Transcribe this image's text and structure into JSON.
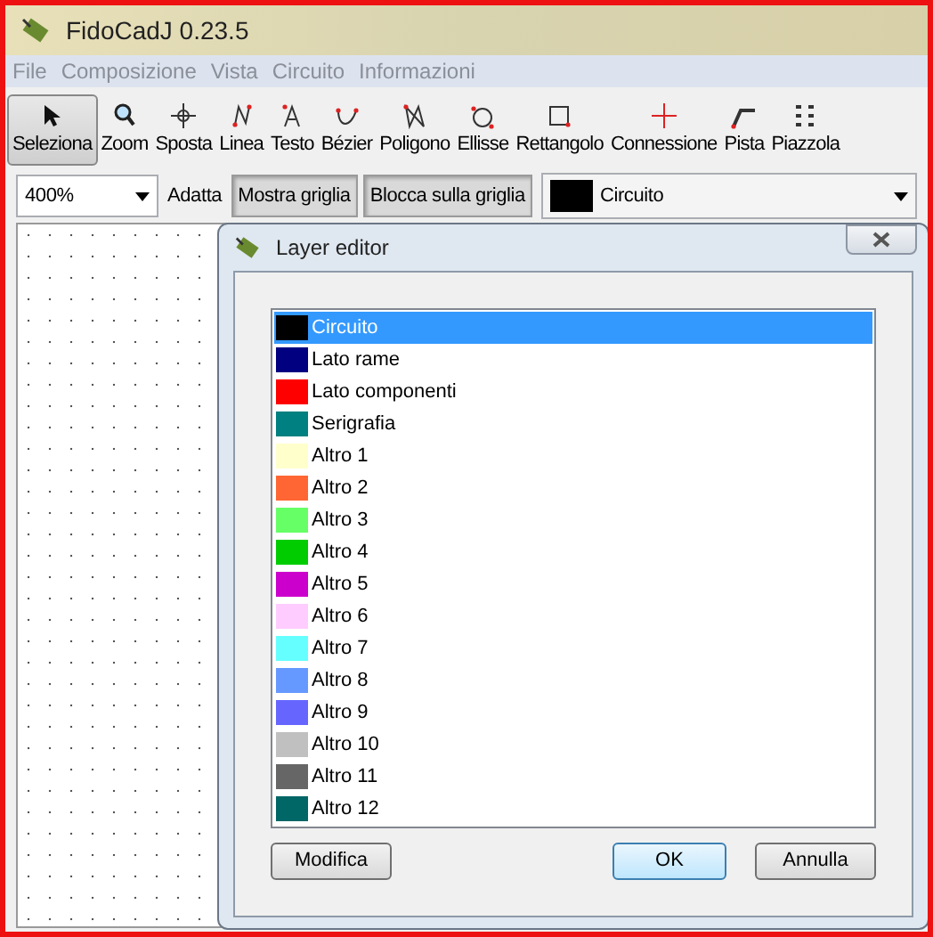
{
  "window": {
    "title": "FidoCadJ 0.23.5"
  },
  "menu": [
    "File",
    "Composizione",
    "Vista",
    "Circuito",
    "Informazioni"
  ],
  "tools": [
    {
      "label": "Seleziona",
      "selected": true
    },
    {
      "label": "Zoom",
      "selected": false
    },
    {
      "label": "Sposta",
      "selected": false
    },
    {
      "label": "Linea",
      "selected": false
    },
    {
      "label": "Testo",
      "selected": false
    },
    {
      "label": "Bézier",
      "selected": false
    },
    {
      "label": "Poligono",
      "selected": false
    },
    {
      "label": "Ellisse",
      "selected": false
    },
    {
      "label": "Rettangolo",
      "selected": false
    },
    {
      "label": "Connessione",
      "selected": false
    },
    {
      "label": "Pista",
      "selected": false
    },
    {
      "label": "Piazzola",
      "selected": false
    }
  ],
  "zoom_select": {
    "value": "400%"
  },
  "fit_button": {
    "label": "Adatta"
  },
  "toggles": [
    {
      "label": "Mostra griglia",
      "on": true
    },
    {
      "label": "Blocca sulla griglia",
      "on": true
    }
  ],
  "layer_select": {
    "value": "Circuito",
    "color": "#000000"
  },
  "dialog": {
    "title": "Layer editor",
    "layers": [
      {
        "name": "Circuito",
        "color": "#000000",
        "selected": true
      },
      {
        "name": "Lato rame",
        "color": "#000080",
        "selected": false
      },
      {
        "name": "Lato componenti",
        "color": "#ff0000",
        "selected": false
      },
      {
        "name": "Serigrafia",
        "color": "#008080",
        "selected": false
      },
      {
        "name": "Altro 1",
        "color": "#ffffcc",
        "selected": false
      },
      {
        "name": "Altro 2",
        "color": "#ff6633",
        "selected": false
      },
      {
        "name": "Altro 3",
        "color": "#66ff66",
        "selected": false
      },
      {
        "name": "Altro 4",
        "color": "#00cc00",
        "selected": false
      },
      {
        "name": "Altro 5",
        "color": "#cc00cc",
        "selected": false
      },
      {
        "name": "Altro 6",
        "color": "#ffccff",
        "selected": false
      },
      {
        "name": "Altro 7",
        "color": "#66ffff",
        "selected": false
      },
      {
        "name": "Altro 8",
        "color": "#6699ff",
        "selected": false
      },
      {
        "name": "Altro 9",
        "color": "#6666ff",
        "selected": false
      },
      {
        "name": "Altro 10",
        "color": "#c0c0c0",
        "selected": false
      },
      {
        "name": "Altro 11",
        "color": "#666666",
        "selected": false
      },
      {
        "name": "Altro 12",
        "color": "#006666",
        "selected": false
      }
    ],
    "buttons": [
      {
        "label": "Modifica",
        "kind": "plain"
      },
      {
        "label": "OK",
        "kind": "default"
      },
      {
        "label": "Annulla",
        "kind": "plain"
      }
    ]
  }
}
